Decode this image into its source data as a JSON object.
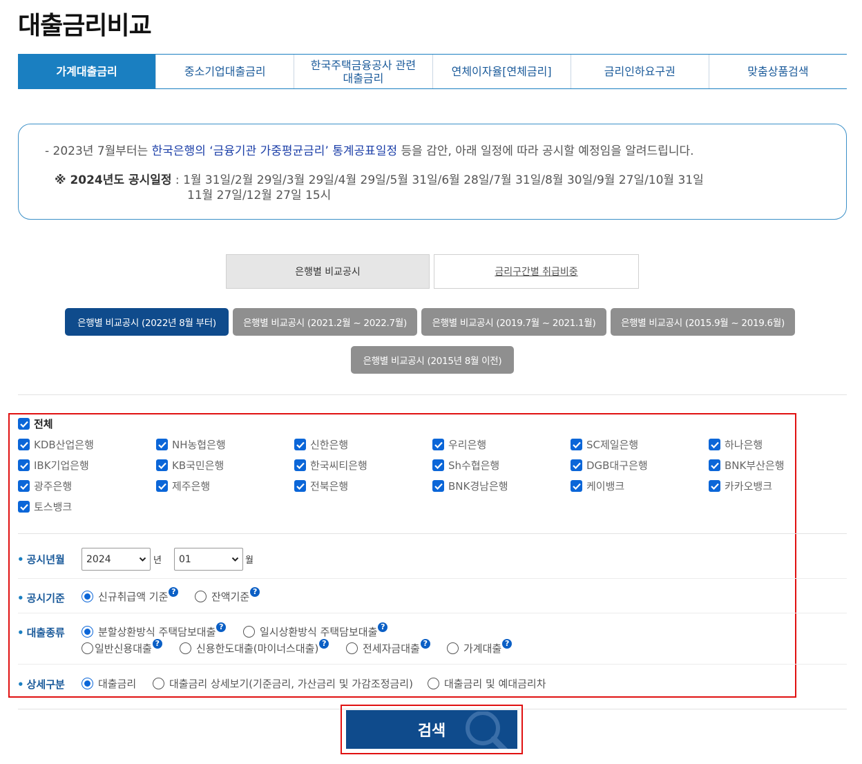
{
  "page_title": "대출금리비교",
  "tabs": [
    {
      "label": "가계대출금리",
      "active": true
    },
    {
      "label": "중소기업대출금리",
      "active": false
    },
    {
      "label": "한국주택금융공사 관련\n대출금리",
      "active": false
    },
    {
      "label": "연체이자율[연체금리]",
      "active": false
    },
    {
      "label": "금리인하요구권",
      "active": false
    },
    {
      "label": "맞춤상품검색",
      "active": false
    }
  ],
  "notice": {
    "line1_prefix": "- 2023년 7월부터는 ",
    "line1_highlight": "한국은행의 ‘금융기관 가중평균금리’ 통계공표일정",
    "line1_suffix": " 등을 감안, 아래 일정에 따라 공시할 예정임을 알려드립니다.",
    "schedule_label": "※ 2024년도 공시일정",
    "schedule_line1": " : 1월 31일/2월 29일/3월 29일/4월 29일/5월 31일/6월 28일/7월 31일/8월 30일/9월 27일/10월 31일",
    "schedule_line2": "11월 27일/12월 27일 15시"
  },
  "segments": [
    {
      "label": "은행별 비교공시",
      "active": true
    },
    {
      "label": "금리구간별 취급비중",
      "active": false
    }
  ],
  "periods": [
    {
      "label": "은행별 비교공시 (2022년 8월 부터)",
      "active": true
    },
    {
      "label": "은행별 비교공시 (2021.2월 ~ 2022.7월)",
      "active": false
    },
    {
      "label": "은행별 비교공시 (2019.7월 ~ 2021.1월)",
      "active": false
    },
    {
      "label": "은행별 비교공시 (2015.9월 ~ 2019.6월)",
      "active": false
    },
    {
      "label": "은행별 비교공시 (2015년 8월 이전)",
      "active": false
    }
  ],
  "banks": {
    "all_label": "전체",
    "items": [
      "KDB산업은행",
      "NH농협은행",
      "신한은행",
      "우리은행",
      "SC제일은행",
      "하나은행",
      "IBK기업은행",
      "KB국민은행",
      "한국씨티은행",
      "Sh수협은행",
      "DGB대구은행",
      "BNK부산은행",
      "광주은행",
      "제주은행",
      "전북은행",
      "BNK경남은행",
      "케이뱅크",
      "카카오뱅크",
      "토스뱅크"
    ]
  },
  "filters": {
    "period": {
      "label": "공시년월",
      "year": "2024",
      "year_unit": "년",
      "month": "01",
      "month_unit": "월"
    },
    "basis": {
      "label": "공시기준",
      "options": [
        "신규취급액 기준",
        "잔액기준"
      ],
      "selected": 0
    },
    "loan_type": {
      "label": "대출종류",
      "options": [
        "분할상환방식 주택담보대출",
        "일시상환방식 주택담보대출",
        "일반신용대출",
        "신용한도대출(마이너스대출)",
        "전세자금대출",
        "가계대출"
      ],
      "selected": 0
    },
    "detail": {
      "label": "상세구분",
      "options": [
        "대출금리",
        "대출금리 상세보기(기준금리, 가산금리 및 가감조정금리)",
        "대출금리 및 예대금리차"
      ],
      "selected": 0
    }
  },
  "search_label": "검색",
  "icons": {
    "checkbox": "check-icon",
    "help": "question-icon",
    "search": "magnifier-icon",
    "dropdown": "chevron-down-icon"
  },
  "colors": {
    "primary": "#1a7fc1",
    "navy": "#0f4b8c",
    "highlight": "#e01010",
    "checkbox": "#0b66d8"
  }
}
